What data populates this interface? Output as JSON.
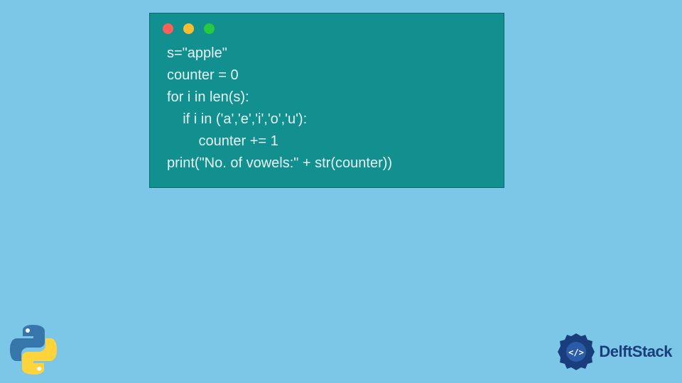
{
  "code": {
    "lines": [
      "s=\"apple\"",
      "counter = 0",
      "for i in len(s):",
      "    if i in ('a','e','i','o','u'):",
      "        counter += 1",
      "print(\"No. of vowels:\" + str(counter))"
    ]
  },
  "branding": {
    "site_name": "DelftStack"
  },
  "colors": {
    "background": "#7cc7e8",
    "code_window": "#128f8f",
    "code_text": "#e8f4f4",
    "delft_blue": "#1a3d7c"
  }
}
